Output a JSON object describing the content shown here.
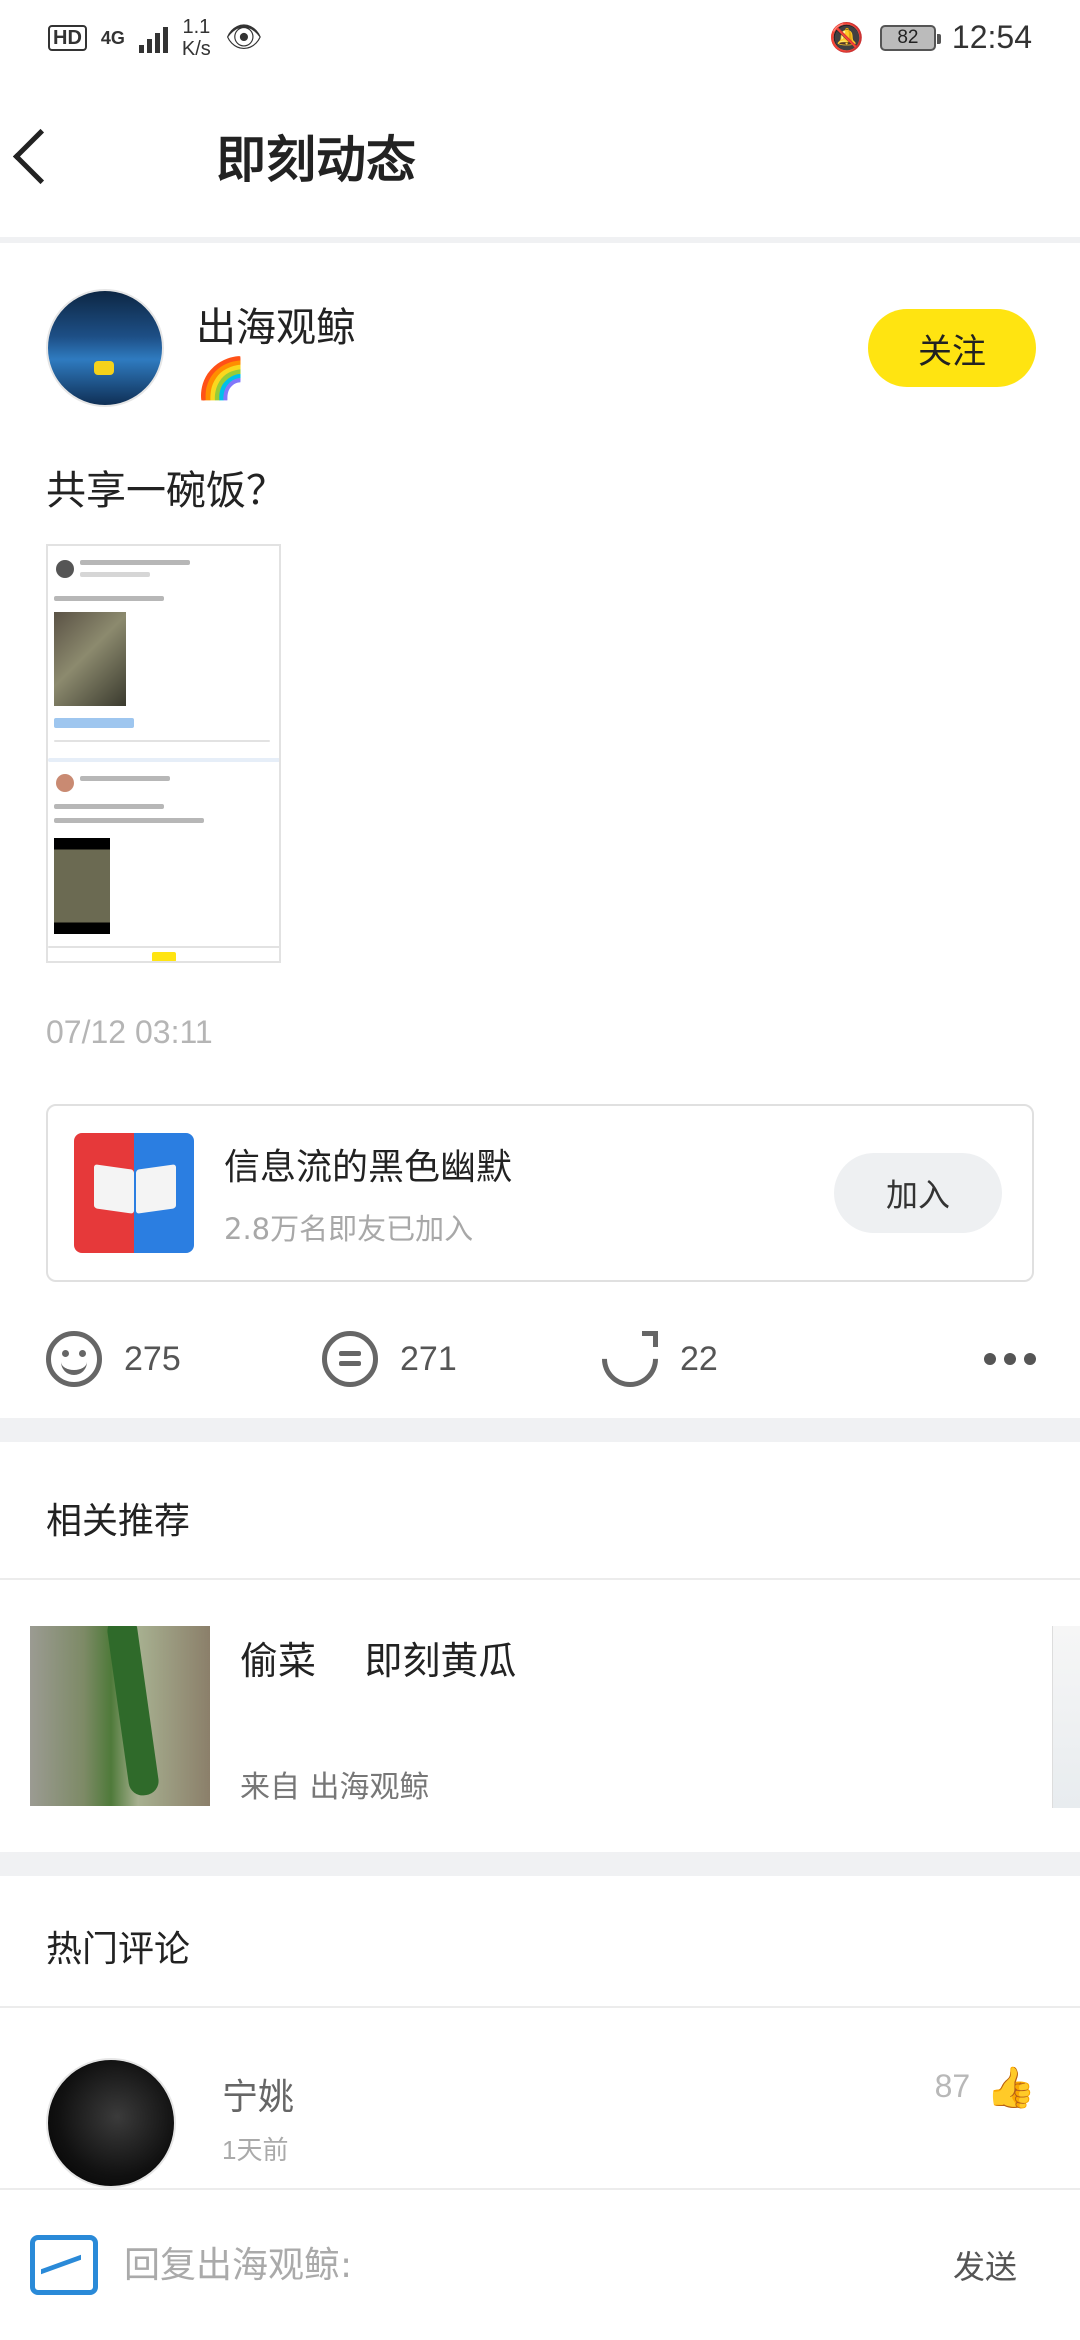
{
  "status_bar": {
    "hd": "HD",
    "network": "4G",
    "speed_value": "1.1",
    "speed_unit": "K/s",
    "battery": "82",
    "time": "12:54",
    "icons": [
      "hd-icon",
      "signal-icon",
      "eye-icon",
      "bell-off-icon",
      "battery-icon"
    ]
  },
  "header": {
    "title": "即刻动态"
  },
  "post": {
    "author_name": "出海观鲸",
    "author_badge": "🌈",
    "follow_label": "关注",
    "text": "共享一碗饭？",
    "time": "07/12 03:11",
    "group": {
      "name": "信息流的黑色幽默",
      "member_count": "2.8万名即友已加入",
      "join_label": "加入"
    },
    "actions": {
      "likes": "275",
      "comments": "271",
      "shares": "22"
    }
  },
  "related": {
    "title": "相关推荐",
    "items": [
      {
        "title": "偷菜    即刻黄瓜",
        "source": "来自 出海观鲸"
      }
    ]
  },
  "hot_comments": {
    "title": "热门评论",
    "items": [
      {
        "name": "宁姚",
        "time": "1天前",
        "likes": "87"
      }
    ]
  },
  "reply_bar": {
    "placeholder": "回复出海观鲸:",
    "send_label": "发送"
  },
  "colors": {
    "accent_yellow": "#ffe411",
    "divider": "#f0f1f3",
    "reply_icon_blue": "#2a8ad8"
  }
}
